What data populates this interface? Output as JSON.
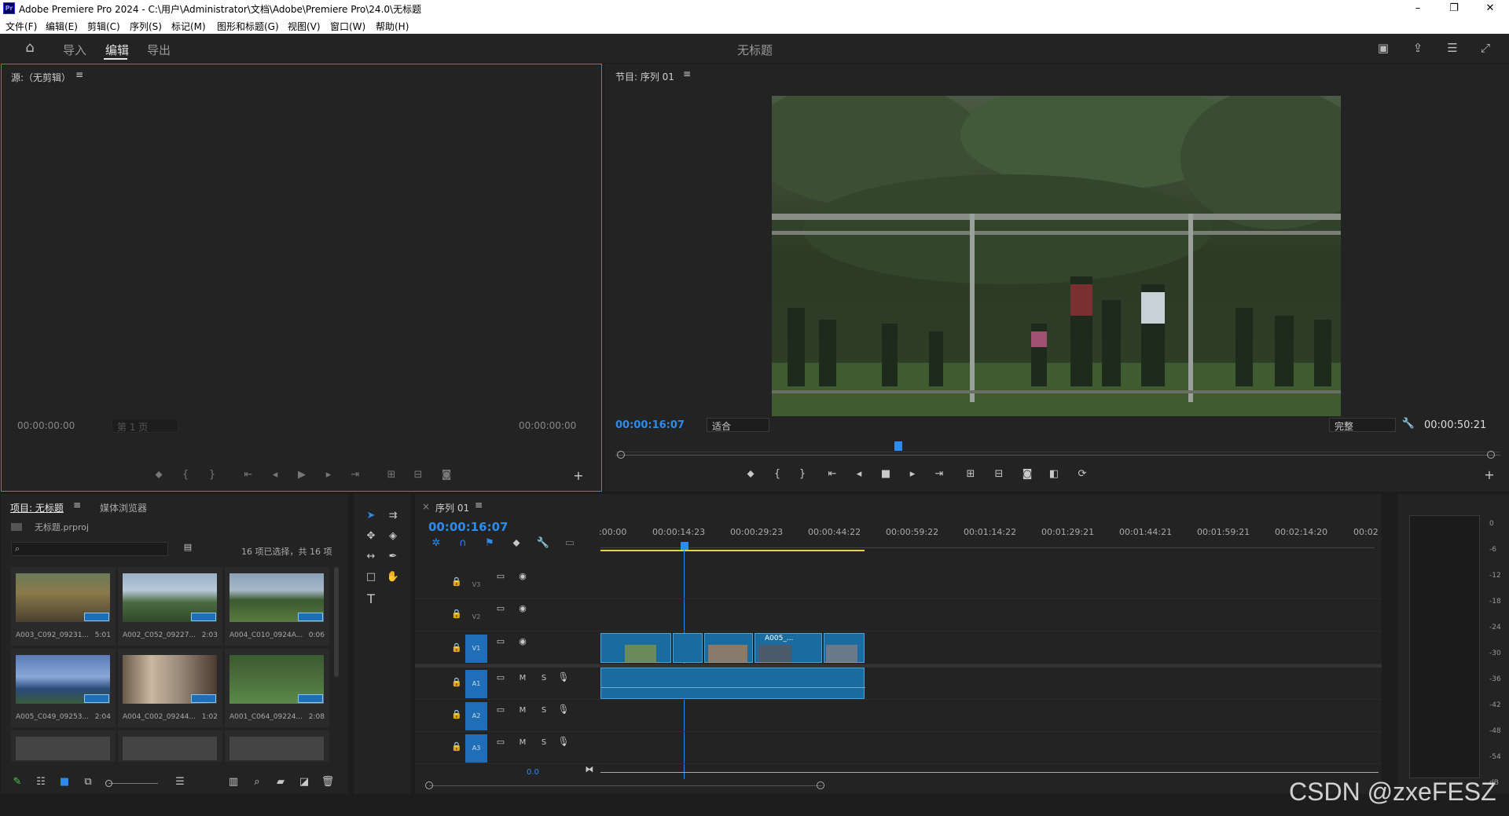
{
  "window": {
    "app_badge": "Pr",
    "title": "Adobe Premiere Pro 2024 - C:\\用户\\Administrator\\文档\\Adobe\\Premiere Pro\\24.0\\无标题",
    "min": "–",
    "max": "❐",
    "close": "✕"
  },
  "menu": [
    "文件(F)",
    "编辑(E)",
    "剪辑(C)",
    "序列(S)",
    "标记(M)",
    "图形和标题(G)",
    "视图(V)",
    "窗口(W)",
    "帮助(H)"
  ],
  "header": {
    "home_icon": "⌂",
    "tabs": [
      "导入",
      "编辑",
      "导出"
    ],
    "active_tab": "编辑",
    "doc_title": "无标题"
  },
  "source": {
    "title": "源:（无剪辑）",
    "menu_icon": "≡",
    "tc_left": "00:00:00:00",
    "page_select": "第 1 页",
    "tc_right": "00:00:00:00"
  },
  "program": {
    "title": "节目: 序列 01",
    "menu_icon": "≡",
    "timecode": "00:00:16:07",
    "fit": "适合",
    "quality": "完整",
    "duration": "00:00:50:21",
    "playhead_fraction": 0.32
  },
  "project": {
    "tab_project": "项目: 无标题",
    "tab_media": "媒体浏览器",
    "file": "无标题.prproj",
    "search_placeholder": "",
    "selection": "16 项已选择，共 16 项",
    "items": [
      {
        "name": "A003_C092_09231...",
        "dur": "5:01"
      },
      {
        "name": "A002_C052_09227...",
        "dur": "2:03"
      },
      {
        "name": "A004_C010_0924A...",
        "dur": "0:06"
      },
      {
        "name": "A005_C049_09253...",
        "dur": "2:04"
      },
      {
        "name": "A004_C002_09244...",
        "dur": "1:02"
      },
      {
        "name": "A001_C064_09224...",
        "dur": "2:08"
      }
    ]
  },
  "timeline": {
    "tab": "序列 01",
    "timecode": "00:00:16:07",
    "ruler": [
      ":00:00",
      "00:00:14:23",
      "00:00:29:23",
      "00:00:44:22",
      "00:00:59:22",
      "00:01:14:22",
      "00:01:29:21",
      "00:01:44:21",
      "00:01:59:21",
      "00:02:14:20",
      "00:02"
    ],
    "video_tracks": [
      "V3",
      "V2",
      "V1"
    ],
    "audio_tracks": [
      "A1",
      "A2",
      "A3"
    ],
    "clip_label": "A005_...",
    "master_volume": "0.0",
    "track_m": "M",
    "track_s": "S"
  },
  "meter": {
    "labels": [
      "0",
      "-6",
      "-12",
      "-18",
      "-24",
      "-30",
      "-36",
      "-42",
      "-48",
      "-54",
      "dB"
    ]
  },
  "watermark": "CSDN @zxeFESZ"
}
